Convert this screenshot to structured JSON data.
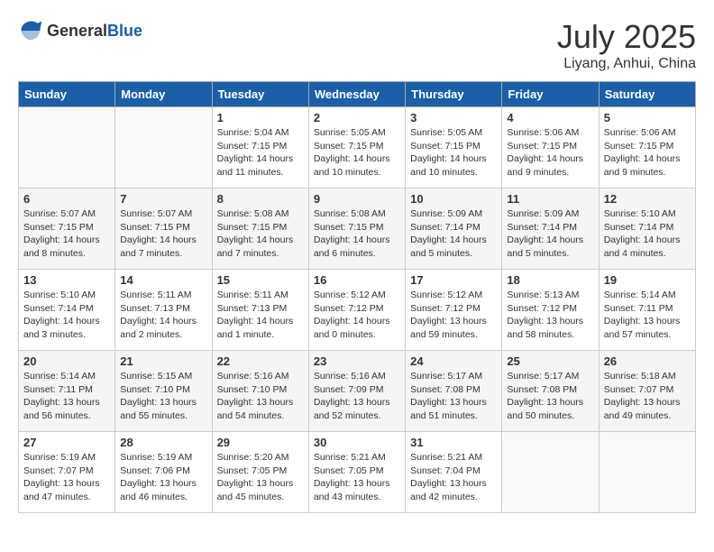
{
  "logo": {
    "general": "General",
    "blue": "Blue"
  },
  "title": "July 2025",
  "location": "Liyang, Anhui, China",
  "days_of_week": [
    "Sunday",
    "Monday",
    "Tuesday",
    "Wednesday",
    "Thursday",
    "Friday",
    "Saturday"
  ],
  "weeks": [
    [
      {
        "day": "",
        "info": ""
      },
      {
        "day": "",
        "info": ""
      },
      {
        "day": "1",
        "info": "Sunrise: 5:04 AM\nSunset: 7:15 PM\nDaylight: 14 hours and 11 minutes."
      },
      {
        "day": "2",
        "info": "Sunrise: 5:05 AM\nSunset: 7:15 PM\nDaylight: 14 hours and 10 minutes."
      },
      {
        "day": "3",
        "info": "Sunrise: 5:05 AM\nSunset: 7:15 PM\nDaylight: 14 hours and 10 minutes."
      },
      {
        "day": "4",
        "info": "Sunrise: 5:06 AM\nSunset: 7:15 PM\nDaylight: 14 hours and 9 minutes."
      },
      {
        "day": "5",
        "info": "Sunrise: 5:06 AM\nSunset: 7:15 PM\nDaylight: 14 hours and 9 minutes."
      }
    ],
    [
      {
        "day": "6",
        "info": "Sunrise: 5:07 AM\nSunset: 7:15 PM\nDaylight: 14 hours and 8 minutes."
      },
      {
        "day": "7",
        "info": "Sunrise: 5:07 AM\nSunset: 7:15 PM\nDaylight: 14 hours and 7 minutes."
      },
      {
        "day": "8",
        "info": "Sunrise: 5:08 AM\nSunset: 7:15 PM\nDaylight: 14 hours and 7 minutes."
      },
      {
        "day": "9",
        "info": "Sunrise: 5:08 AM\nSunset: 7:15 PM\nDaylight: 14 hours and 6 minutes."
      },
      {
        "day": "10",
        "info": "Sunrise: 5:09 AM\nSunset: 7:14 PM\nDaylight: 14 hours and 5 minutes."
      },
      {
        "day": "11",
        "info": "Sunrise: 5:09 AM\nSunset: 7:14 PM\nDaylight: 14 hours and 5 minutes."
      },
      {
        "day": "12",
        "info": "Sunrise: 5:10 AM\nSunset: 7:14 PM\nDaylight: 14 hours and 4 minutes."
      }
    ],
    [
      {
        "day": "13",
        "info": "Sunrise: 5:10 AM\nSunset: 7:14 PM\nDaylight: 14 hours and 3 minutes."
      },
      {
        "day": "14",
        "info": "Sunrise: 5:11 AM\nSunset: 7:13 PM\nDaylight: 14 hours and 2 minutes."
      },
      {
        "day": "15",
        "info": "Sunrise: 5:11 AM\nSunset: 7:13 PM\nDaylight: 14 hours and 1 minute."
      },
      {
        "day": "16",
        "info": "Sunrise: 5:12 AM\nSunset: 7:12 PM\nDaylight: 14 hours and 0 minutes."
      },
      {
        "day": "17",
        "info": "Sunrise: 5:12 AM\nSunset: 7:12 PM\nDaylight: 13 hours and 59 minutes."
      },
      {
        "day": "18",
        "info": "Sunrise: 5:13 AM\nSunset: 7:12 PM\nDaylight: 13 hours and 58 minutes."
      },
      {
        "day": "19",
        "info": "Sunrise: 5:14 AM\nSunset: 7:11 PM\nDaylight: 13 hours and 57 minutes."
      }
    ],
    [
      {
        "day": "20",
        "info": "Sunrise: 5:14 AM\nSunset: 7:11 PM\nDaylight: 13 hours and 56 minutes."
      },
      {
        "day": "21",
        "info": "Sunrise: 5:15 AM\nSunset: 7:10 PM\nDaylight: 13 hours and 55 minutes."
      },
      {
        "day": "22",
        "info": "Sunrise: 5:16 AM\nSunset: 7:10 PM\nDaylight: 13 hours and 54 minutes."
      },
      {
        "day": "23",
        "info": "Sunrise: 5:16 AM\nSunset: 7:09 PM\nDaylight: 13 hours and 52 minutes."
      },
      {
        "day": "24",
        "info": "Sunrise: 5:17 AM\nSunset: 7:08 PM\nDaylight: 13 hours and 51 minutes."
      },
      {
        "day": "25",
        "info": "Sunrise: 5:17 AM\nSunset: 7:08 PM\nDaylight: 13 hours and 50 minutes."
      },
      {
        "day": "26",
        "info": "Sunrise: 5:18 AM\nSunset: 7:07 PM\nDaylight: 13 hours and 49 minutes."
      }
    ],
    [
      {
        "day": "27",
        "info": "Sunrise: 5:19 AM\nSunset: 7:07 PM\nDaylight: 13 hours and 47 minutes."
      },
      {
        "day": "28",
        "info": "Sunrise: 5:19 AM\nSunset: 7:06 PM\nDaylight: 13 hours and 46 minutes."
      },
      {
        "day": "29",
        "info": "Sunrise: 5:20 AM\nSunset: 7:05 PM\nDaylight: 13 hours and 45 minutes."
      },
      {
        "day": "30",
        "info": "Sunrise: 5:21 AM\nSunset: 7:05 PM\nDaylight: 13 hours and 43 minutes."
      },
      {
        "day": "31",
        "info": "Sunrise: 5:21 AM\nSunset: 7:04 PM\nDaylight: 13 hours and 42 minutes."
      },
      {
        "day": "",
        "info": ""
      },
      {
        "day": "",
        "info": ""
      }
    ]
  ]
}
